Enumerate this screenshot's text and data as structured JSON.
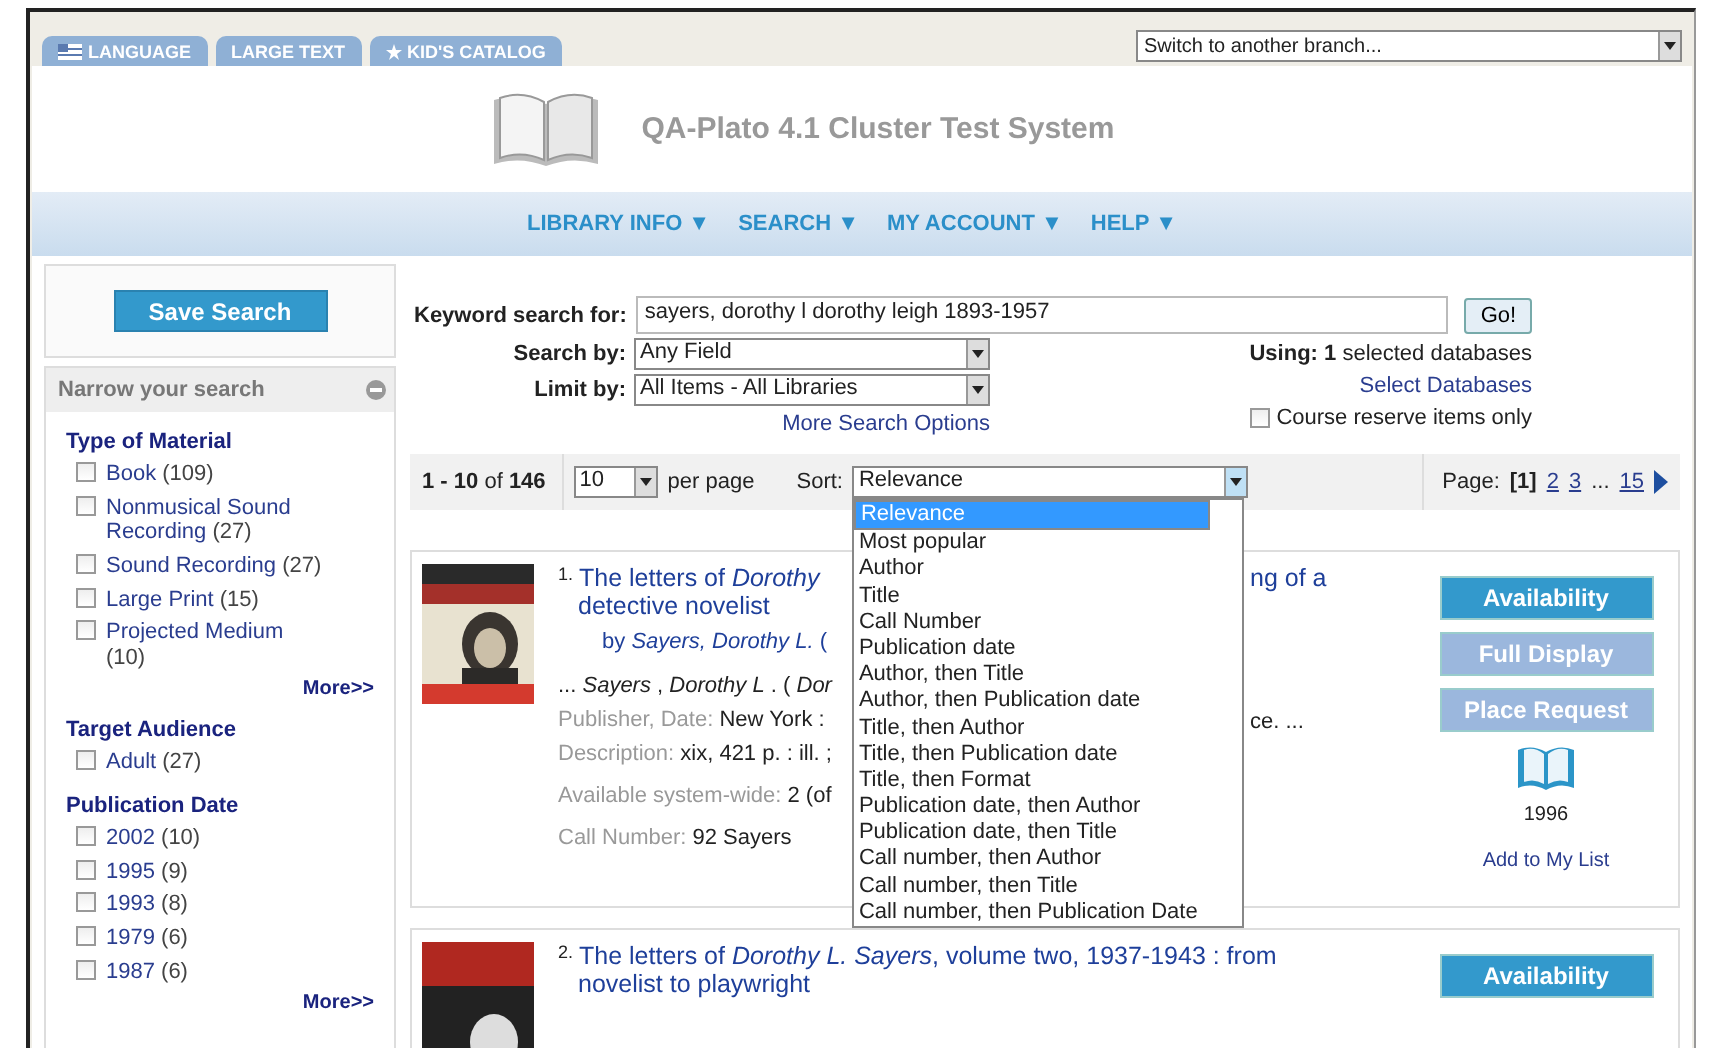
{
  "top_tabs": [
    {
      "label": "LANGUAGE",
      "kind": "flag"
    },
    {
      "label": "LARGE TEXT",
      "kind": "plain"
    },
    {
      "label": "KID'S CATALOG",
      "kind": "star"
    }
  ],
  "branch_select": {
    "value": "Switch to another branch..."
  },
  "site_title": "QA-Plato 4.1 Cluster Test System",
  "nav": [
    {
      "label": "LIBRARY INFO ▼"
    },
    {
      "label": "SEARCH ▼"
    },
    {
      "label": "MY ACCOUNT ▼"
    },
    {
      "label": "HELP ▼"
    }
  ],
  "sidebar": {
    "save_button": "Save Search",
    "narrow_heading": "Narrow your search",
    "facets": [
      {
        "heading": "Type of Material",
        "more": "More>>",
        "items": [
          {
            "label": "Book",
            "count": "(109)",
            "checked": false
          },
          {
            "label": "Nonmusical Sound Recording",
            "count": "(27)",
            "checked": false
          },
          {
            "label": "Sound Recording",
            "count": "(27)",
            "checked": false
          },
          {
            "label": "Large Print",
            "count": "(15)",
            "checked": false
          },
          {
            "label": "Projected Medium",
            "count": "(10)",
            "checked": false
          }
        ]
      },
      {
        "heading": "Target Audience",
        "items": [
          {
            "label": "Adult",
            "count": "(27)",
            "checked": false
          }
        ]
      },
      {
        "heading": "Publication Date",
        "more": "More>>",
        "items": [
          {
            "label": "2002",
            "count": "(10)",
            "checked": false
          },
          {
            "label": "1995",
            "count": "(9)",
            "checked": false
          },
          {
            "label": "1993",
            "count": "(8)",
            "checked": false
          },
          {
            "label": "1979",
            "count": "(6)",
            "checked": false
          },
          {
            "label": "1987",
            "count": "(6)",
            "checked": false
          }
        ]
      }
    ]
  },
  "search": {
    "keyword_label": "Keyword search for:",
    "keyword": "sayers, dorothy l dorothy leigh 1893-1957",
    "go": "Go!",
    "search_by_label": "Search by:",
    "search_by": "Any Field",
    "limit_by_label": "Limit by:",
    "limit_by": "All Items - All Libraries",
    "more_options": "More Search Options",
    "using": "**Using: 1** selected databases",
    "select_databases": "Select Databases",
    "course_reserve": {
      "label": "Course reserve items only",
      "checked": false
    }
  },
  "results_bar": {
    "range": "**1 - 10** of **146**",
    "per_page": "10",
    "per_page_label": "per page",
    "sort_label": "Sort:",
    "sort_value": "Relevance",
    "sort_options": [
      {
        "label": "Relevance",
        "selected": true
      },
      {
        "label": "Most popular",
        "selected": false
      },
      {
        "label": "Author",
        "selected": false
      },
      {
        "label": "Title",
        "selected": false
      },
      {
        "label": "Call Number",
        "selected": false
      },
      {
        "label": "Publication date",
        "selected": false
      },
      {
        "label": "Author, then Title",
        "selected": false
      },
      {
        "label": "Author, then Publication date",
        "selected": false
      },
      {
        "label": "Title, then Author",
        "selected": false
      },
      {
        "label": "Title, then Publication date",
        "selected": false
      },
      {
        "label": "Title, then Format",
        "selected": false
      },
      {
        "label": "Publication date, then Author",
        "selected": false
      },
      {
        "label": "Publication date, then Title",
        "selected": false
      },
      {
        "label": "Call number, then Author",
        "selected": false
      },
      {
        "label": "Call number, then Title",
        "selected": false
      },
      {
        "label": "Call number, then Publication Date",
        "selected": false
      }
    ],
    "page_label": "Page:",
    "pages": [
      {
        "label": "[1]",
        "selected": true
      },
      {
        "label": "2",
        "selected": false
      },
      {
        "label": "3",
        "selected": false
      }
    ],
    "ellipsis": "...",
    "last_page": "15"
  },
  "results": [
    {
      "number": "1.",
      "title": "The letters of *Dorothy*",
      "title_tail": "ng of a",
      "title_line2": "detective novelist",
      "by": "by *Sayers, Dorothy L.* (",
      "snippet": "... *Sayers* , *Dorothy L* . ( *Dor*",
      "snippet_tail": "ce. ...",
      "fields": [
        {
          "label": "Publisher, Date:",
          "value": "New York :"
        },
        {
          "label": "Description:",
          "value": "xix, 421 p. : ill. ;"
        },
        {
          "label": "Available system-wide:",
          "value": "2 (of"
        },
        {
          "label": "Call Number:",
          "value": "92 Sayers"
        }
      ],
      "buttons": [
        {
          "label": "Availability",
          "enabled": true
        },
        {
          "label": "Full Display",
          "enabled": false
        },
        {
          "label": "Place Request",
          "enabled": false
        }
      ],
      "year": "1996",
      "add_list": "Add to My List"
    },
    {
      "number": "2.",
      "title": "The letters of *Dorothy L. Sayers*, volume two, 1937-1943 : from",
      "title_line2": "novelist to playwright",
      "buttons": [
        {
          "label": "Availability",
          "enabled": true
        }
      ]
    }
  ]
}
